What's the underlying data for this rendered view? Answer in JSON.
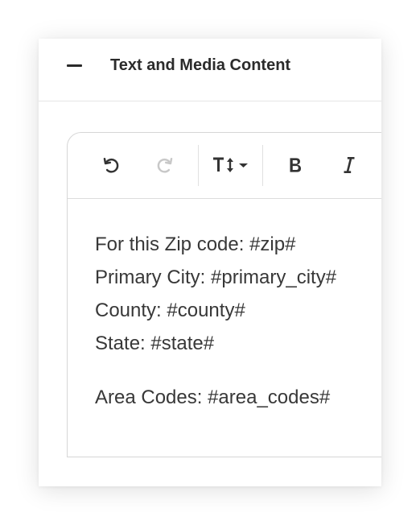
{
  "section": {
    "title": "Text and Media Content",
    "collapse_icon": "minus-icon"
  },
  "toolbar": {
    "buttons": [
      {
        "name": "undo",
        "icon": "undo-icon",
        "enabled": true
      },
      {
        "name": "redo",
        "icon": "redo-icon",
        "enabled": false
      },
      {
        "name": "text-size",
        "icon": "text-size-icon",
        "enabled": true
      },
      {
        "name": "bold",
        "icon": "bold-icon",
        "label": "B",
        "enabled": true
      },
      {
        "name": "italic",
        "icon": "italic-icon",
        "label": "I",
        "enabled": true
      }
    ]
  },
  "content": {
    "lines": [
      "For this Zip code: #zip#",
      "Primary City: #primary_city#",
      "County: #county#",
      "State: #state#"
    ],
    "area_codes": "Area Codes: #area_codes#"
  },
  "colors": {
    "text": "#383838",
    "title": "#2b2b2b",
    "icon": "#333333",
    "icon_disabled": "#c8c8c8",
    "border": "#d6d6d6"
  }
}
